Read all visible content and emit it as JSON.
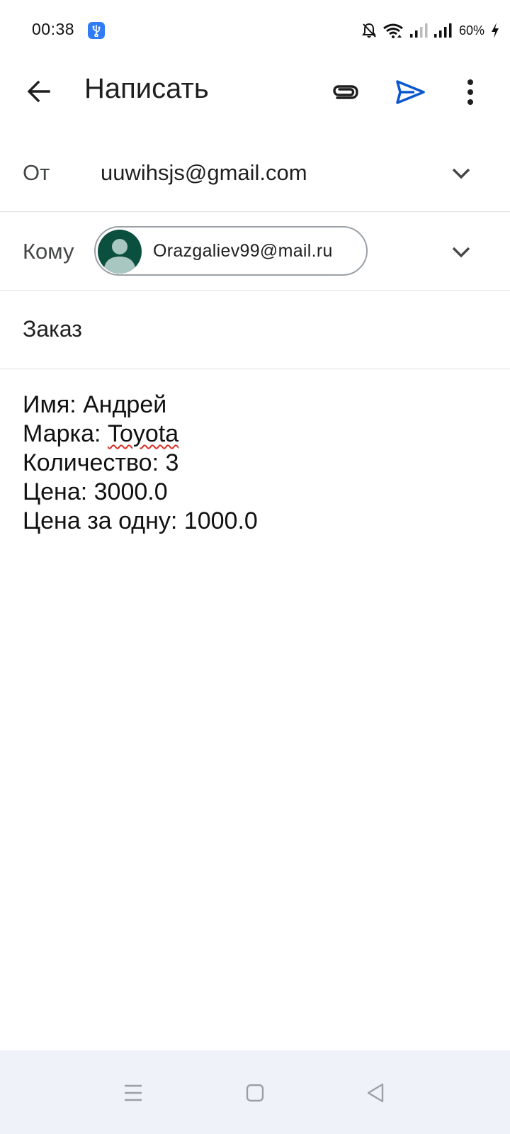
{
  "status_bar": {
    "time": "00:38",
    "battery": "60%",
    "icons": [
      "usb-icon",
      "bell-off-icon",
      "wifi-icon",
      "signal-icon",
      "signal-icon",
      "battery-charging-icon"
    ]
  },
  "app_bar": {
    "title": "Написать",
    "icons": [
      "arrow-back-icon",
      "attach-icon",
      "send-icon",
      "more-vert-icon"
    ],
    "accent_color": "#0b57d0"
  },
  "compose": {
    "from_label": "От",
    "from_value": "uuwihsjs@gmail.com",
    "to_label": "Кому",
    "to_recipient": "Orazgaliev99@mail.ru",
    "subject": "Заказ",
    "body_lines": [
      "Имя: Андрей",
      "Марка: ",
      "Toyota",
      "Количество: 3",
      "Цена: 3000.0",
      "Цена за одну: 1000.0"
    ]
  },
  "nav_bar": {
    "icons": [
      "menu-icon",
      "home-icon",
      "back-icon"
    ]
  }
}
